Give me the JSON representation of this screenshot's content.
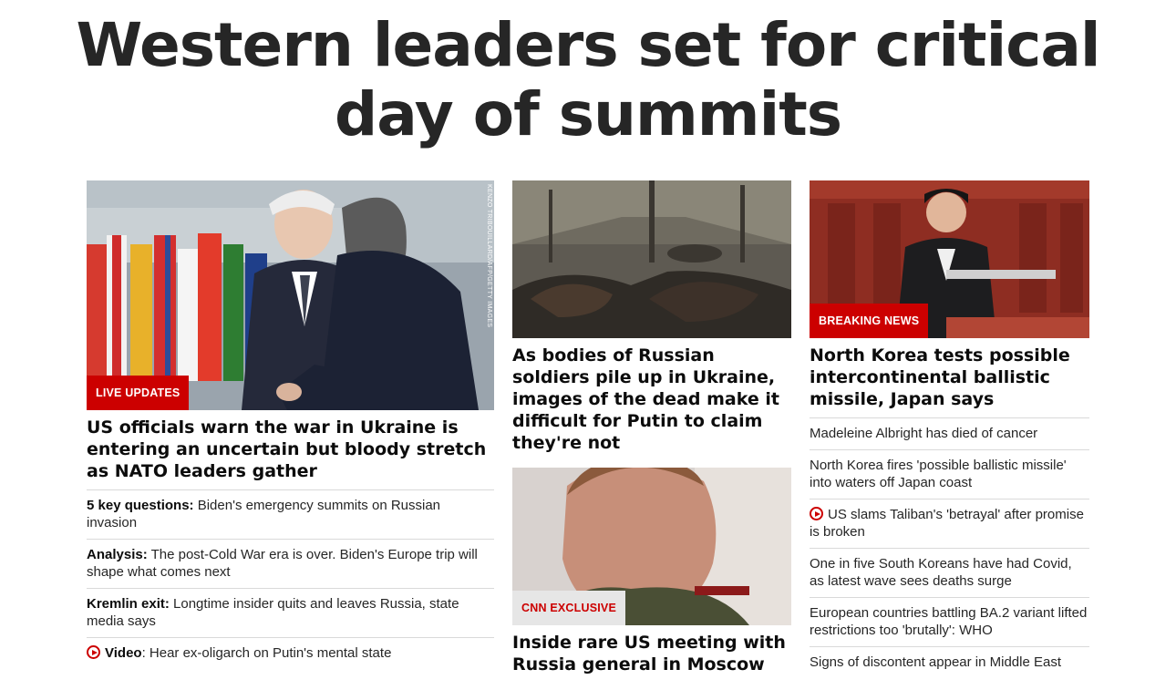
{
  "headline": {
    "line1": "Western leaders set for critical",
    "line2": "day of summits"
  },
  "lead": {
    "image_credit": "KENZO TRIBOUILLARD/AFP/GETTY IMAGES",
    "label": "LIVE UPDATES",
    "title": "US officials warn the war in Ukraine is entering an uncertain but bloody stretch as NATO leaders gather",
    "items": [
      {
        "prefix": "5 key questions:",
        "text": " Biden's emergency summits on Russian invasion"
      },
      {
        "prefix": "Analysis:",
        "text": " The post-Cold War era is over. Biden's Europe trip will shape what comes next"
      },
      {
        "prefix": "Kremlin exit:",
        "text": " Longtime insider quits and leaves Russia, state media says"
      },
      {
        "prefix": "Video",
        "text": ": Hear ex-oligarch on Putin's mental state"
      }
    ]
  },
  "middle": {
    "story1_title": "As bodies of Russian soldiers pile up in Ukraine, images of the dead make it difficult for Putin to claim they're not",
    "story2_label": "CNN EXCLUSIVE",
    "story2_title": "Inside rare US meeting with Russia general in Moscow"
  },
  "right": {
    "label": "BREAKING NEWS",
    "title": "North Korea tests possible intercontinental ballistic missile, Japan says",
    "items": [
      "Madeleine Albright has died of cancer",
      "North Korea fires 'possible ballistic missile' into waters off Japan coast",
      "US slams Taliban's 'betrayal' after promise is broken",
      "One in five South Koreans have had Covid, as latest wave sees deaths surge",
      "European countries battling BA.2 variant lifted restrictions too 'brutally': WHO",
      "Signs of discontent appear in Middle East"
    ]
  },
  "colors": {
    "accent": "#cc0000",
    "text": "#0c0c0c",
    "divider": "#d9d9d9"
  }
}
